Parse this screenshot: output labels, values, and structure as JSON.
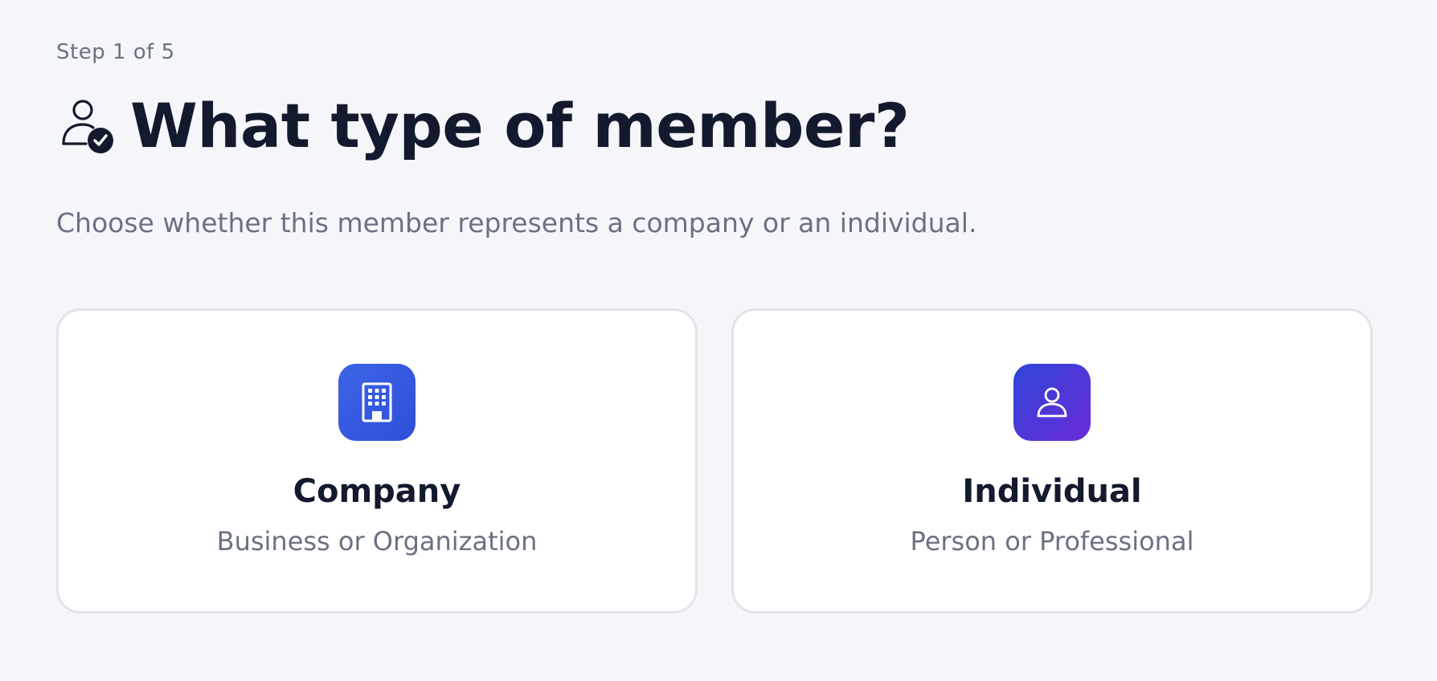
{
  "header": {
    "step_text": "Step 1 of 5",
    "title": "What type of member?",
    "title_icon": "user-check-icon",
    "subtitle": "Choose whether this member represents a company or an individual."
  },
  "options": [
    {
      "title": "Company",
      "description": "Business or Organization",
      "icon": "building-icon",
      "icon_color": "#3558e0"
    },
    {
      "title": "Individual",
      "description": "Person or Professional",
      "icon": "person-icon",
      "icon_color": "#4a36d8"
    }
  ],
  "colors": {
    "background": "#f5f6fa",
    "heading": "#141a2e",
    "muted": "#6b7180",
    "card_border": "#e3e4ea"
  }
}
